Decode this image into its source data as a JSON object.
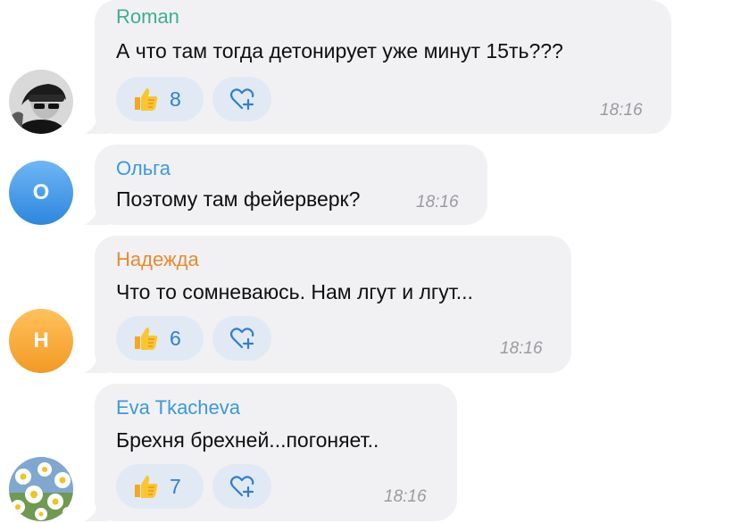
{
  "colors": {
    "bubble": "#f1f1f4",
    "reaction_bg": "#e1e9f4",
    "reaction_count": "#2f7fd2",
    "time": "#9a9aa0",
    "sender_roman": "#3eae8f",
    "sender_olga": "#3a9ad9",
    "sender_nadezhda": "#e98a2e",
    "sender_eva": "#3a9ad9"
  },
  "messages": [
    {
      "sender": "Roman",
      "avatar_icon": "photo-avatar-icon",
      "text": "А что там тогда детонирует уже минут 15ть???",
      "likes": "8",
      "time": "18:16"
    },
    {
      "sender": "Ольга",
      "avatar_letter": "О",
      "text": "Поэтому там фейерверк?",
      "time": "18:16"
    },
    {
      "sender": "Надежда",
      "avatar_letter": "Н",
      "text": "Что то сомневаюсь. Нам лгут и лгут...",
      "likes": "6",
      "time": "18:16"
    },
    {
      "sender": "Eva Tkacheva",
      "avatar_icon": "daisies-avatar-icon",
      "text": "Брехня брехней...погоняет..",
      "likes": "7",
      "time": "18:16"
    }
  ]
}
